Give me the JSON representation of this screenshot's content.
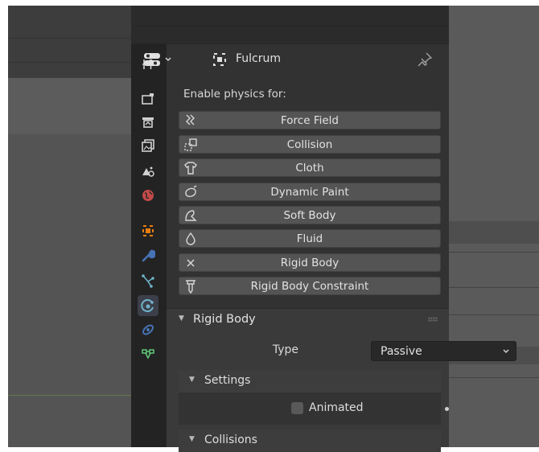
{
  "object": {
    "name": "Fulcrum"
  },
  "physics": {
    "enable_label": "Enable physics for:",
    "buttons": [
      {
        "label": "Force Field",
        "icon": "force-field-icon"
      },
      {
        "label": "Collision",
        "icon": "collision-icon"
      },
      {
        "label": "Cloth",
        "icon": "cloth-icon"
      },
      {
        "label": "Dynamic Paint",
        "icon": "dynamic-paint-icon"
      },
      {
        "label": "Soft Body",
        "icon": "soft-body-icon"
      },
      {
        "label": "Fluid",
        "icon": "fluid-icon"
      },
      {
        "label": "Rigid Body",
        "icon": "close-x-icon"
      },
      {
        "label": "Rigid Body Constraint",
        "icon": "rigid-body-constraint-icon"
      }
    ]
  },
  "rigid_body_panel": {
    "title": "Rigid Body",
    "type_label": "Type",
    "type_value": "Passive",
    "settings": {
      "title": "Settings",
      "animated_label": "Animated",
      "animated_checked": false
    },
    "collisions": {
      "title": "Collisions"
    }
  },
  "tabs": [
    "tool-tab-icon",
    "render-tab-icon",
    "output-tab-icon",
    "view-layer-tab-icon",
    "scene-tab-icon",
    "world-tab-icon",
    "object-tab-icon",
    "modifiers-tab-icon",
    "particles-tab-icon",
    "physics-tab-icon",
    "constraints-tab-icon",
    "data-tab-icon"
  ],
  "colors": {
    "accent_blue": "#4772b3",
    "object_orange": "#e87d0d",
    "world_red": "#e64d4d",
    "particles_teal": "#6fb3c9",
    "data_green": "#5fc97a"
  }
}
